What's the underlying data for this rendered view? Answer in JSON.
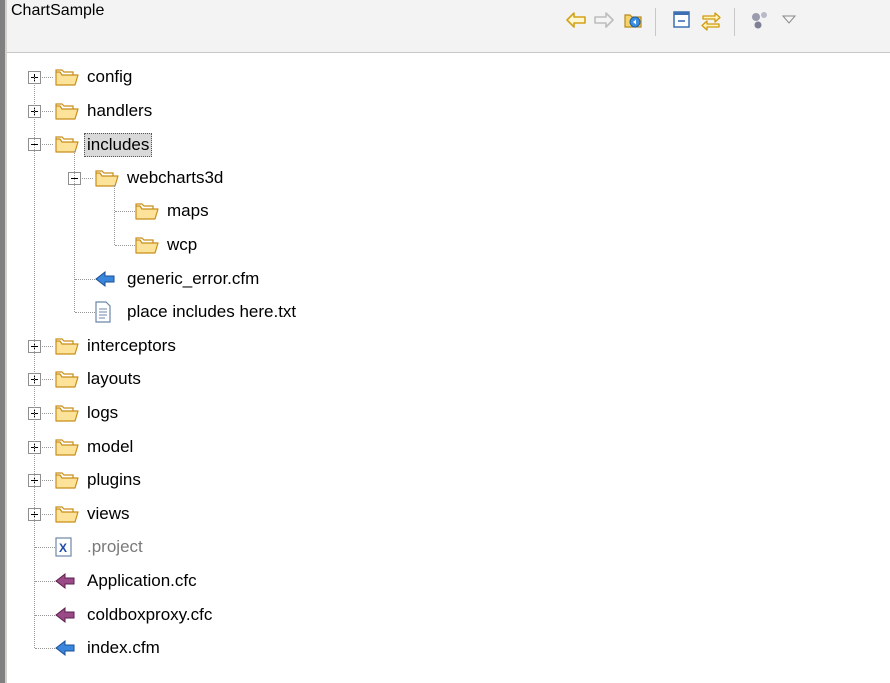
{
  "header": {
    "title": "ChartSample",
    "toolbar": [
      "back-arrow-icon",
      "forward-arrow-icon",
      "home-icon",
      "collapse-all-icon",
      "link-with-editor-icon",
      "view-menu-icon",
      "dropdown-icon"
    ]
  },
  "tree": {
    "items": [
      {
        "label": "config",
        "type": "folder",
        "depth": 0,
        "expander": "plus"
      },
      {
        "label": "handlers",
        "type": "folder",
        "depth": 0,
        "expander": "plus"
      },
      {
        "label": "includes",
        "type": "folder",
        "depth": 0,
        "expander": "minus",
        "selected": true
      },
      {
        "label": "webcharts3d",
        "type": "folder",
        "depth": 1,
        "expander": "minus"
      },
      {
        "label": "maps",
        "type": "folder",
        "depth": 2
      },
      {
        "label": "wcp",
        "type": "folder",
        "depth": 2
      },
      {
        "label": "generic_error.cfm",
        "type": "cfm",
        "depth": 1
      },
      {
        "label": "place includes here.txt",
        "type": "txt",
        "depth": 1
      },
      {
        "label": "interceptors",
        "type": "folder",
        "depth": 0,
        "expander": "plus"
      },
      {
        "label": "layouts",
        "type": "folder",
        "depth": 0,
        "expander": "plus"
      },
      {
        "label": "logs",
        "type": "folder",
        "depth": 0,
        "expander": "plus"
      },
      {
        "label": "model",
        "type": "folder",
        "depth": 0,
        "expander": "plus"
      },
      {
        "label": "plugins",
        "type": "folder",
        "depth": 0,
        "expander": "plus"
      },
      {
        "label": "views",
        "type": "folder",
        "depth": 0,
        "expander": "plus"
      },
      {
        "label": ".project",
        "type": "project",
        "depth": 0,
        "dim": true
      },
      {
        "label": "Application.cfc",
        "type": "cfc",
        "depth": 0
      },
      {
        "label": "coldboxproxy.cfc",
        "type": "cfc",
        "depth": 0
      },
      {
        "label": "index.cfm",
        "type": "cfm",
        "depth": 0
      }
    ]
  },
  "colors": {
    "folder": "#f3c05a",
    "cfm": "#2f7fd6",
    "cfc": "#8a3a78",
    "selection": "#d9d9d9"
  }
}
